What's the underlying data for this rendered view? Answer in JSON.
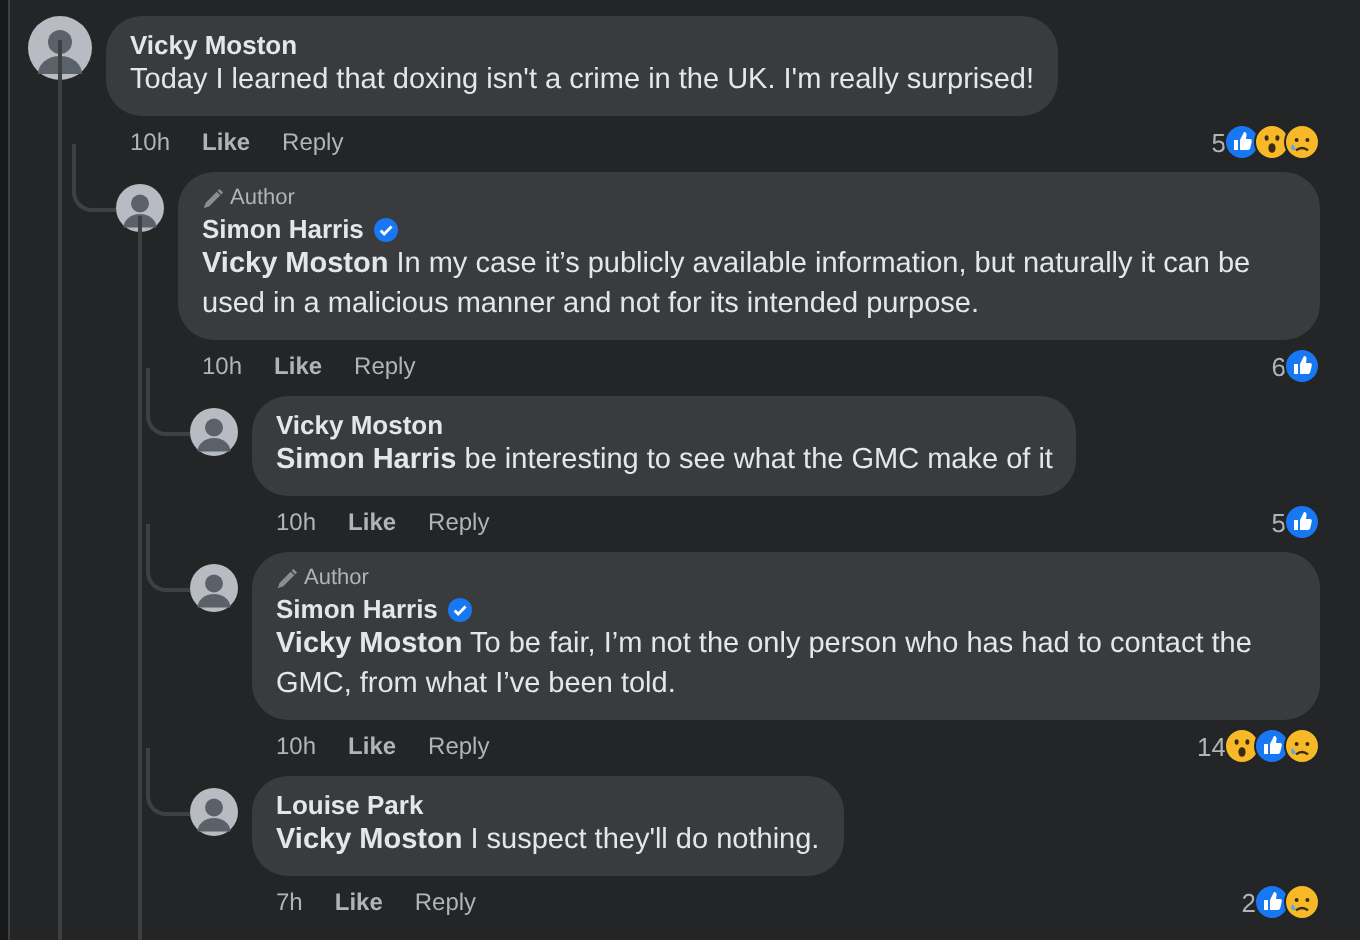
{
  "comments": [
    {
      "author": "Vicky Moston",
      "verified": false,
      "text": "Today I learned that doxing isn't a crime in the UK. I'm really surprised!",
      "time": "10h",
      "like": "Like",
      "reply": "Reply",
      "reaction_count": "5",
      "reactions": [
        {
          "kind": "like"
        },
        {
          "kind": "wow"
        },
        {
          "kind": "sad"
        }
      ],
      "children": [
        {
          "author": "Simon Harris",
          "badge": "Author",
          "verified": true,
          "text": "**Vicky Moston** In my case it’s publicly available information, but naturally it can be used in a malicious manner and not for its intended purpose.",
          "time": "10h",
          "like": "Like",
          "reply": "Reply",
          "reaction_count": "6",
          "reactions": [
            {
              "kind": "like"
            }
          ],
          "children": [
            {
              "author": "Vicky Moston",
              "verified": false,
              "text": "**Simon Harris** be interesting to see what the GMC make of it",
              "time": "10h",
              "like": "Like",
              "reply": "Reply",
              "reaction_count": "5",
              "reactions": [
                {
                  "kind": "like"
                }
              ]
            },
            {
              "author": "Simon Harris",
              "badge": "Author",
              "verified": true,
              "text": "**Vicky Moston** To be fair, I’m not the only person who has had to contact the GMC, from what I’ve been told.",
              "time": "10h",
              "like": "Like",
              "reply": "Reply",
              "reaction_count": "14",
              "reactions": [
                {
                  "kind": "wow"
                },
                {
                  "kind": "like"
                },
                {
                  "kind": "sad"
                }
              ]
            },
            {
              "author": "Louise Park",
              "verified": false,
              "text": "**Vicky Moston** I suspect they'll do nothing.",
              "time": "7h",
              "like": "Like",
              "reply": "Reply",
              "reaction_count": "2",
              "reactions": [
                {
                  "kind": "like"
                },
                {
                  "kind": "sad"
                }
              ]
            }
          ]
        }
      ]
    }
  ]
}
